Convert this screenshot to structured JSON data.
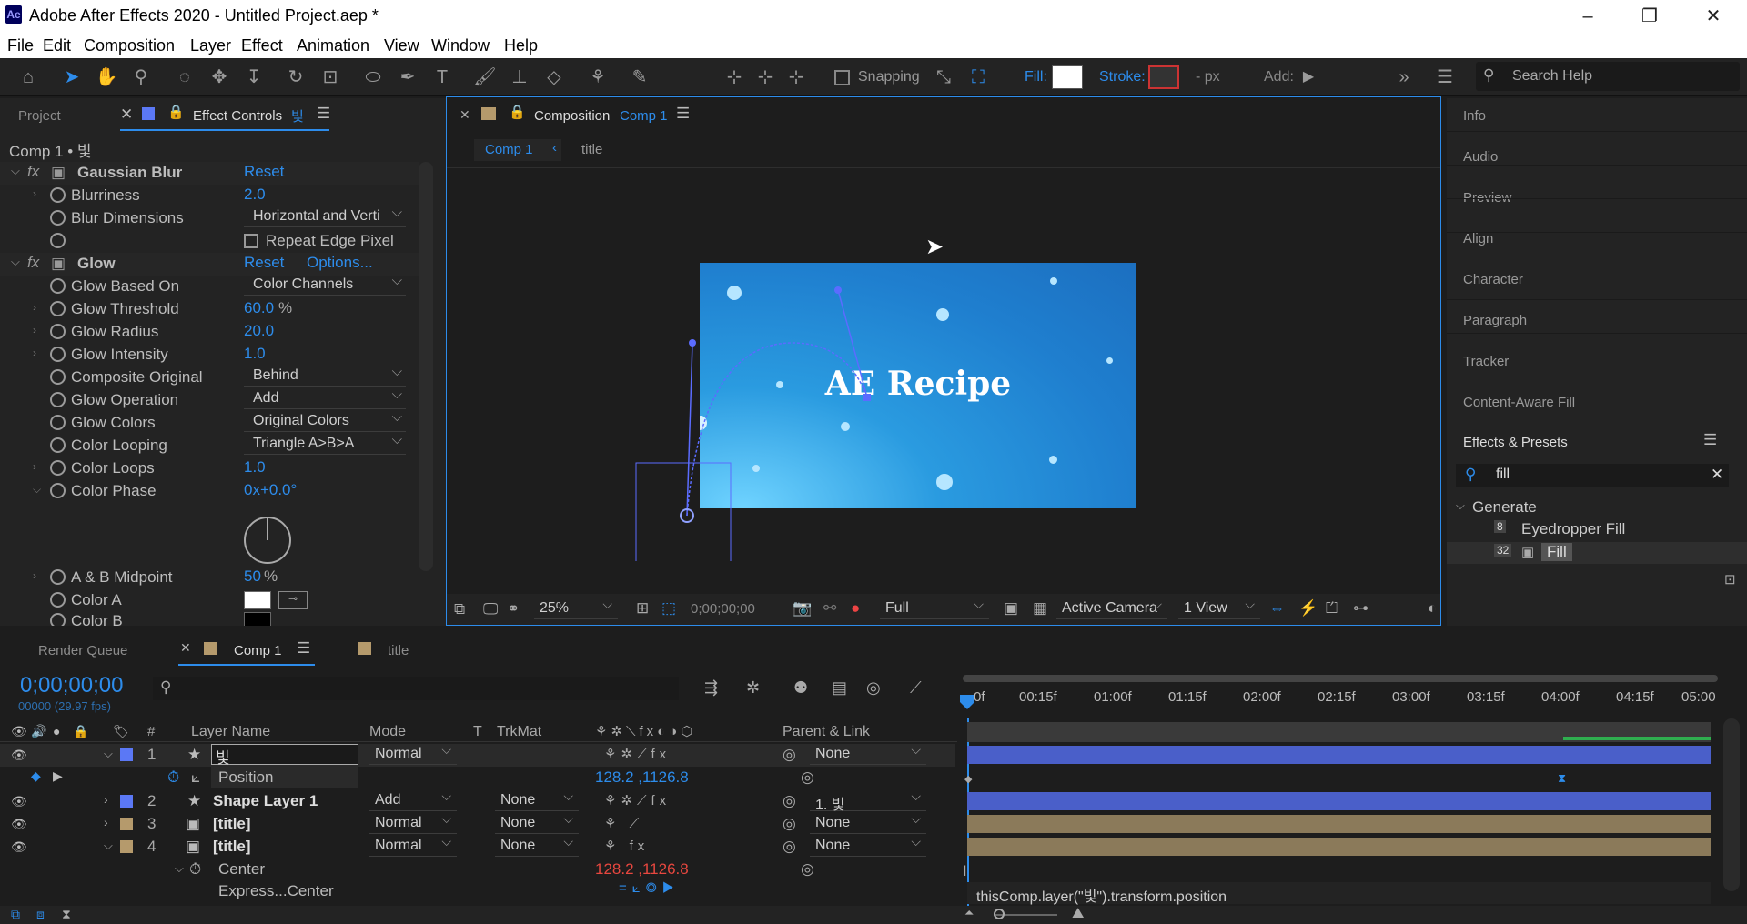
{
  "window": {
    "title": "Adobe After Effects 2020 - Untitled Project.aep *",
    "logo": "Ae",
    "min": "–",
    "max": "❐",
    "close": "✕"
  },
  "menu": [
    "File",
    "Edit",
    "Composition",
    "Layer",
    "Effect",
    "Animation",
    "View",
    "Window",
    "Help"
  ],
  "toolbar": {
    "snapping": "Snapping",
    "fill": "Fill:",
    "stroke": "Stroke:",
    "px": "- px",
    "add": "Add:",
    "search": "Search Help"
  },
  "left_panel": {
    "tab_project": "Project",
    "tab_effect_controls": "Effect Controls",
    "tab_layer_glyph": "빛",
    "header": "Comp 1 • 빛",
    "effects": [
      {
        "name": "Gaussian Blur",
        "reset": "Reset"
      },
      {
        "name": "Glow",
        "reset": "Reset",
        "options": "Options..."
      }
    ],
    "props": {
      "blurriness": {
        "label": "Blurriness",
        "value": "2.0"
      },
      "blur_dimensions": {
        "label": "Blur Dimensions",
        "value": "Horizontal and Verti"
      },
      "repeat_edge": {
        "label": "Repeat Edge Pixel"
      },
      "glow_based_on": {
        "label": "Glow Based On",
        "value": "Color Channels"
      },
      "glow_threshold": {
        "label": "Glow Threshold",
        "value": "60.0",
        "unit": "%"
      },
      "glow_radius": {
        "label": "Glow Radius",
        "value": "20.0"
      },
      "glow_intensity": {
        "label": "Glow Intensity",
        "value": "1.0"
      },
      "composite_original": {
        "label": "Composite Original",
        "value": "Behind"
      },
      "glow_operation": {
        "label": "Glow Operation",
        "value": "Add"
      },
      "glow_colors": {
        "label": "Glow Colors",
        "value": "Original Colors"
      },
      "color_looping": {
        "label": "Color Looping",
        "value": "Triangle A>B>A"
      },
      "color_loops": {
        "label": "Color Loops",
        "value": "1.0"
      },
      "color_phase": {
        "label": "Color Phase",
        "value": "0x+0.0°"
      },
      "ab_midpoint": {
        "label": "A & B Midpoint",
        "value": "50",
        "unit": "%"
      },
      "color_a": {
        "label": "Color A"
      },
      "color_b": {
        "label": "Color B"
      }
    }
  },
  "composition": {
    "panel_label": "Composition",
    "comp_name": "Comp 1",
    "breadcrumbs": [
      "Comp 1",
      "title"
    ],
    "canvas_text": "AE Recipe",
    "footer": {
      "zoom": "25%",
      "timecode": "0;00;00;00",
      "resolution": "Full",
      "camera": "Active Camera",
      "views": "1 View"
    }
  },
  "right_panel": {
    "items": [
      "Info",
      "Audio",
      "Preview",
      "Align",
      "Character",
      "Paragraph",
      "Tracker",
      "Content-Aware Fill"
    ],
    "effects_presets": "Effects & Presets",
    "search_value": "fill",
    "group": "Generate",
    "results": [
      {
        "badge": "8",
        "name": "Eyedropper Fill"
      },
      {
        "badge": "32",
        "name": "Fill"
      }
    ]
  },
  "timeline": {
    "tabs": [
      "Render Queue",
      "Comp 1",
      "title"
    ],
    "timecode": "0;00;00;00",
    "fps": "00000 (29.97 fps)",
    "columns": {
      "num": "#",
      "layer_name": "Layer Name",
      "mode": "Mode",
      "t": "T",
      "trkmat": "TrkMat",
      "parent": "Parent & Link"
    },
    "ruler": [
      "0f",
      "00:15f",
      "01:00f",
      "01:15f",
      "02:00f",
      "02:15f",
      "03:00f",
      "03:15f",
      "04:00f",
      "04:15f",
      "05:00"
    ],
    "layers": [
      {
        "num": "1",
        "name": "빛",
        "mode": "Normal",
        "trkmat": "",
        "parent": "None"
      },
      {
        "num": "2",
        "name": "Shape Layer 1",
        "mode": "Add",
        "trkmat": "None",
        "parent": "1. 빛"
      },
      {
        "num": "3",
        "name": "[title]",
        "mode": "Normal",
        "trkmat": "None",
        "parent": "None"
      },
      {
        "num": "4",
        "name": "[title]",
        "mode": "Normal",
        "trkmat": "None",
        "parent": "None"
      }
    ],
    "position": {
      "label": "Position",
      "value": "128.2 ,1126.8"
    },
    "center": {
      "label": "Center",
      "value": "128.2 ,1126.8"
    },
    "expression_label": "Express...Center",
    "expression": "thisComp.layer(\"빛\").transform.position"
  },
  "colors": {
    "accent": "#2d8ceb",
    "comp_bg": "#2a9be0",
    "layer_blue": "#4a5fc9",
    "layer_tan": "#8b7a5a"
  }
}
